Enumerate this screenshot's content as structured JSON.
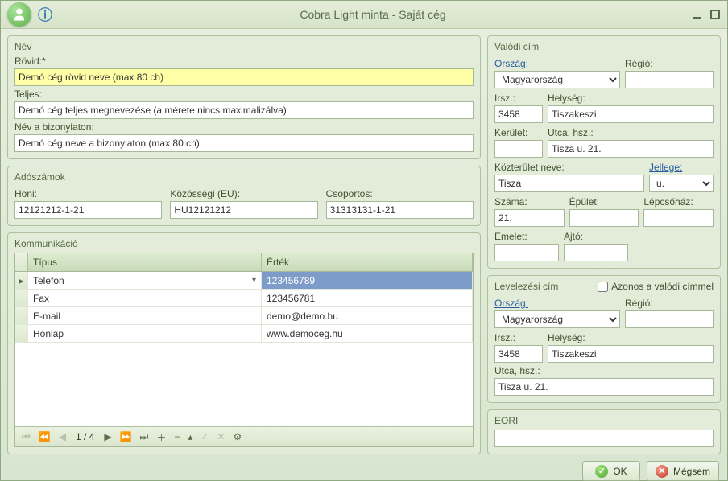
{
  "window": {
    "title": "Cobra Light minta - Saját cég"
  },
  "nev": {
    "title": "Név",
    "rovid_label": "Rövid:*",
    "rovid": "Demó cég rövid neve (max 80 ch)",
    "teljes_label": "Teljes:",
    "teljes": "Demó cég teljes megnevezése (a mérete nincs maximalizálva)",
    "bizonylat_label": "Név a bizonylaton:",
    "bizonylat": "Demó cég neve a bizonylaton (max 80 ch)"
  },
  "adoszamok": {
    "title": "Adószámok",
    "honi_label": "Honi:",
    "honi": "12121212-1-21",
    "kozossegi_label": "Közösségi (EU):",
    "kozossegi": "HU12121212",
    "csoportos_label": "Csoportos:",
    "csoportos": "31313131-1-21"
  },
  "kommunikacio": {
    "title": "Kommunikáció",
    "col_tipus": "Típus",
    "col_ertek": "Érték",
    "rows": [
      {
        "tipus": "Telefon",
        "ertek": "123456789"
      },
      {
        "tipus": "Fax",
        "ertek": "123456781"
      },
      {
        "tipus": "E-mail",
        "ertek": "demo@demo.hu"
      },
      {
        "tipus": "Honlap",
        "ertek": "www.democeg.hu"
      }
    ],
    "nav_position": "1 / 4"
  },
  "valodi": {
    "title": "Valódi cím",
    "orszag_label": "Ország:",
    "orszag": "Magyarország",
    "regio_label": "Régió:",
    "regio": "",
    "irsz_label": "Irsz.:",
    "irsz": "3458",
    "helyseg_label": "Helység:",
    "helyseg": "Tiszakeszi",
    "kerulet_label": "Kerület:",
    "kerulet": "",
    "utca_label": "Utca, hsz.:",
    "utca": "Tisza u. 21.",
    "kozterulet_label": "Közterület neve:",
    "kozterulet": "Tisza",
    "jellege_label": "Jellege:",
    "jellege": "u.",
    "szama_label": "Száma:",
    "szama": "21.",
    "epulet_label": "Épület:",
    "epulet": "",
    "lepcsohaz_label": "Lépcsőház:",
    "lepcsohaz": "",
    "emelet_label": "Emelet:",
    "emelet": "",
    "ajto_label": "Ajtó:",
    "ajto": ""
  },
  "levelezesi": {
    "title": "Levelezési cím",
    "azonos_label": "Azonos a valódi címmel",
    "orszag_label": "Ország:",
    "orszag": "Magyarország",
    "regio_label": "Régió:",
    "regio": "",
    "irsz_label": "Irsz.:",
    "irsz": "3458",
    "helyseg_label": "Helység:",
    "helyseg": "Tiszakeszi",
    "utca_label": "Utca, hsz.:",
    "utca": "Tisza u. 21."
  },
  "eori": {
    "title": "EORI",
    "value": ""
  },
  "buttons": {
    "ok": "OK",
    "cancel": "Mégsem"
  }
}
